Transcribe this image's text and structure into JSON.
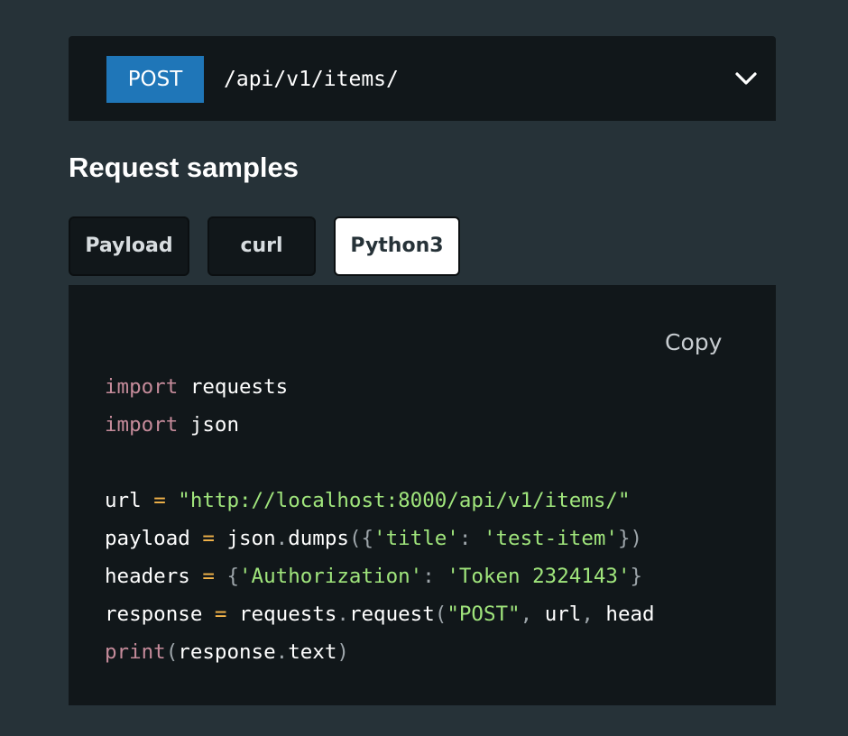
{
  "endpoint": {
    "method": "POST",
    "path": "/api/v1/items/",
    "method_color": "#1f76b8",
    "toggle_icon": "chevron-down-icon"
  },
  "section_title": "Request samples",
  "tabs": [
    {
      "label": "Payload",
      "active": false
    },
    {
      "label": "curl",
      "active": false
    },
    {
      "label": "Python3",
      "active": true
    }
  ],
  "code_panel": {
    "copy_label": "Copy",
    "syntax_colors": {
      "keyword": "#c58b9a",
      "operator": "#f5b54a",
      "string": "#a0e57c",
      "punctuation": "#9ea6ab",
      "text": "#ffffff"
    },
    "lines": [
      {
        "name": "code-line-import-requests",
        "tokens": [
          {
            "t": "kw",
            "v": "import"
          },
          {
            "t": "plain",
            "v": " requests"
          }
        ]
      },
      {
        "name": "code-line-import-json",
        "tokens": [
          {
            "t": "kw",
            "v": "import"
          },
          {
            "t": "plain",
            "v": " json"
          }
        ]
      },
      {
        "name": "code-line-blank",
        "tokens": []
      },
      {
        "name": "code-line-url",
        "tokens": [
          {
            "t": "plain",
            "v": "url "
          },
          {
            "t": "op",
            "v": "="
          },
          {
            "t": "plain",
            "v": " "
          },
          {
            "t": "str",
            "v": "\"http://localhost:8000/api/v1/items/\""
          }
        ]
      },
      {
        "name": "code-line-payload",
        "tokens": [
          {
            "t": "plain",
            "v": "payload "
          },
          {
            "t": "op",
            "v": "="
          },
          {
            "t": "plain",
            "v": " json"
          },
          {
            "t": "punc",
            "v": "."
          },
          {
            "t": "plain",
            "v": "dumps"
          },
          {
            "t": "punc",
            "v": "({"
          },
          {
            "t": "str",
            "v": "'title'"
          },
          {
            "t": "punc",
            "v": ": "
          },
          {
            "t": "str",
            "v": "'test-item'"
          },
          {
            "t": "punc",
            "v": "})"
          }
        ]
      },
      {
        "name": "code-line-headers",
        "tokens": [
          {
            "t": "plain",
            "v": "headers "
          },
          {
            "t": "op",
            "v": "="
          },
          {
            "t": "plain",
            "v": " "
          },
          {
            "t": "punc",
            "v": "{"
          },
          {
            "t": "str",
            "v": "'Authorization'"
          },
          {
            "t": "punc",
            "v": ": "
          },
          {
            "t": "str",
            "v": "'Token 2324143'"
          },
          {
            "t": "punc",
            "v": "}"
          }
        ]
      },
      {
        "name": "code-line-response",
        "tokens": [
          {
            "t": "plain",
            "v": "response "
          },
          {
            "t": "op",
            "v": "="
          },
          {
            "t": "plain",
            "v": " requests"
          },
          {
            "t": "punc",
            "v": "."
          },
          {
            "t": "plain",
            "v": "request"
          },
          {
            "t": "punc",
            "v": "("
          },
          {
            "t": "str",
            "v": "\"POST\""
          },
          {
            "t": "punc",
            "v": ", "
          },
          {
            "t": "plain",
            "v": "url"
          },
          {
            "t": "punc",
            "v": ", "
          },
          {
            "t": "plain",
            "v": "head"
          }
        ]
      },
      {
        "name": "code-line-print",
        "tokens": [
          {
            "t": "kw",
            "v": "print"
          },
          {
            "t": "punc",
            "v": "("
          },
          {
            "t": "plain",
            "v": "response"
          },
          {
            "t": "punc",
            "v": "."
          },
          {
            "t": "plain",
            "v": "text"
          },
          {
            "t": "punc",
            "v": ")"
          }
        ]
      }
    ]
  }
}
